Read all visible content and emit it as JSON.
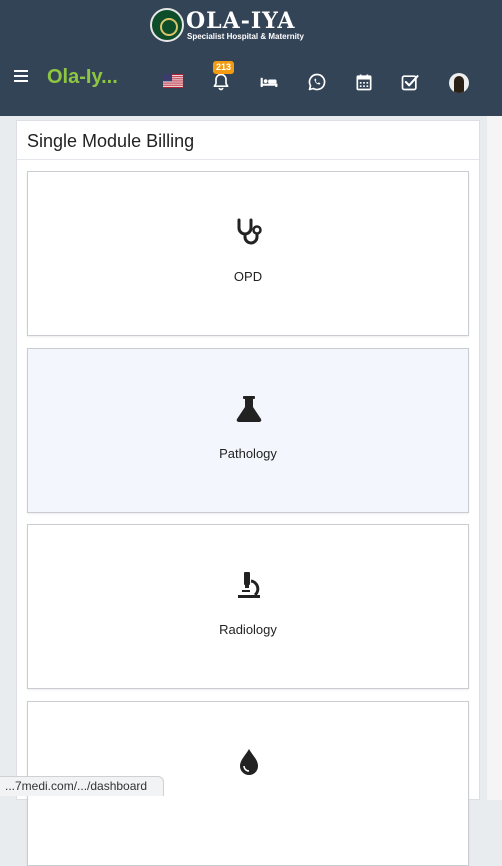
{
  "header": {
    "logo_name": "OLA-IYA",
    "logo_tagline": "Specialist Hospital & Maternity",
    "brand": "Ola-Iy...",
    "notification_count": "213",
    "bg_color": "#344457",
    "brand_color": "#8dc641",
    "badge_color": "#f39c12",
    "icons": [
      "menu-icon",
      "us-flag-icon",
      "bell-icon",
      "bed-icon",
      "whatsapp-icon",
      "calendar-icon",
      "check-square-icon",
      "user-avatar"
    ]
  },
  "panel": {
    "title": "Single Module Billing",
    "cards": [
      {
        "label": "OPD",
        "icon": "stethoscope-icon"
      },
      {
        "label": "Pathology",
        "icon": "flask-icon"
      },
      {
        "label": "Radiology",
        "icon": "microscope-icon"
      },
      {
        "label": "",
        "icon": "blood-drop-icon"
      }
    ]
  },
  "statusbar": {
    "url": "...7medi.com/.../dashboard"
  }
}
